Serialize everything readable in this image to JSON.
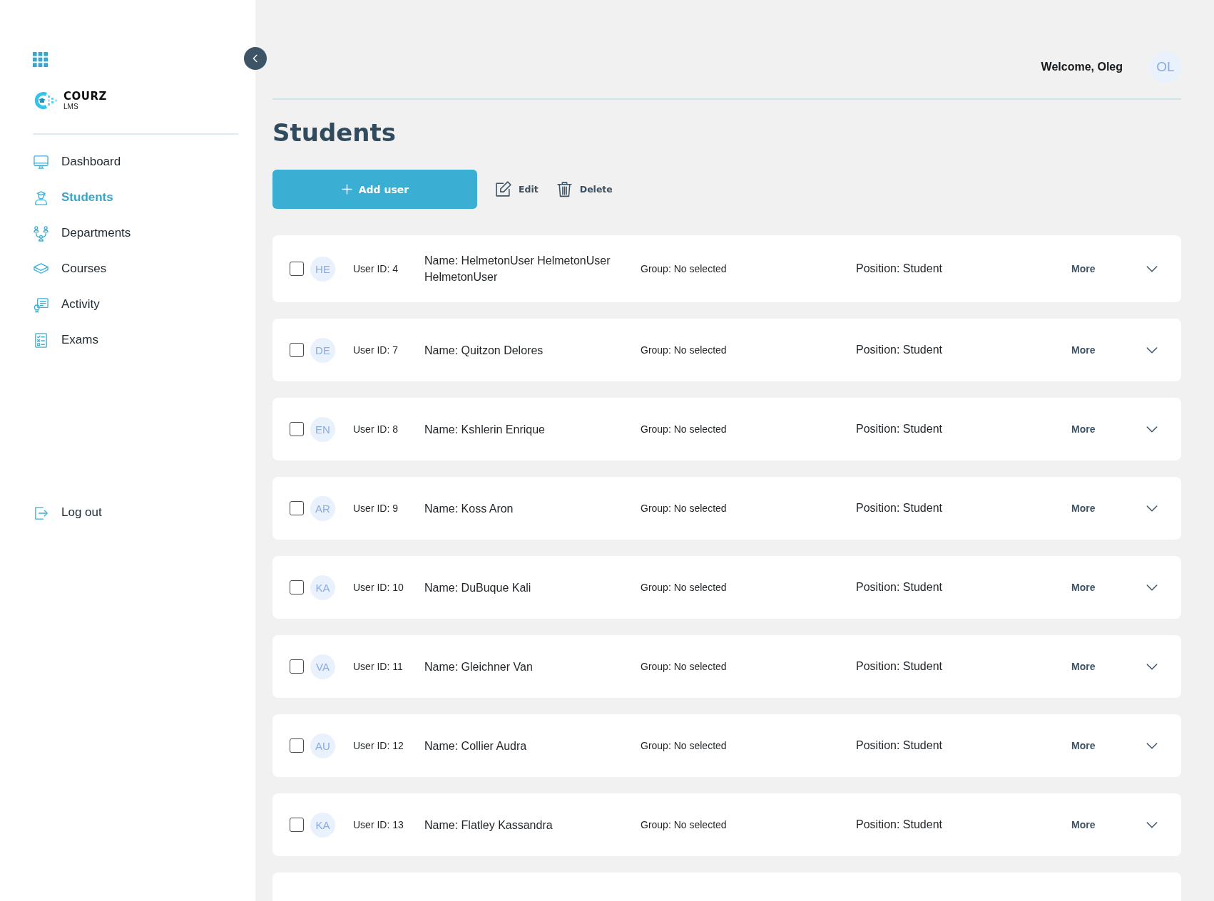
{
  "sidebar": {
    "logo": {
      "name": "COURZ",
      "tagline": "LMS"
    },
    "nav": [
      {
        "label": "Dashboard",
        "selected": false
      },
      {
        "label": "Students",
        "selected": true
      },
      {
        "label": "Departments",
        "selected": false
      },
      {
        "label": "Courses",
        "selected": false
      },
      {
        "label": "Activity",
        "selected": false
      },
      {
        "label": "Exams",
        "selected": false
      }
    ],
    "logout": {
      "label": "Log out"
    }
  },
  "header": {
    "welcome": "Welcome, Oleg",
    "avatar": "OL"
  },
  "page": {
    "title": "Students",
    "toolbar": {
      "add_user": "Add user",
      "edit": "Edit",
      "delete": "Delete"
    }
  },
  "rows": [
    {
      "checked": false,
      "initials": "HE",
      "user_id": "User ID: 4",
      "name": "Name: HelmetonUser HelmetonUser HelmetonUser",
      "group": "Group: No selected",
      "position": "Position: Student",
      "more": "More",
      "expanded": false
    },
    {
      "checked": false,
      "initials": "DE",
      "user_id": "User ID: 7",
      "name": "Name: Quitzon Delores",
      "group": "Group: No selected",
      "position": "Position: Student",
      "more": "More",
      "expanded": false
    },
    {
      "checked": false,
      "initials": "EN",
      "user_id": "User ID: 8",
      "name": "Name: Kshlerin Enrique",
      "group": "Group: No selected",
      "position": "Position: Student",
      "more": "More",
      "expanded": false
    },
    {
      "checked": false,
      "initials": "AR",
      "user_id": "User ID: 9",
      "name": "Name: Koss Aron",
      "group": "Group: No selected",
      "position": "Position: Student",
      "more": "More",
      "expanded": false
    },
    {
      "checked": false,
      "initials": "KA",
      "user_id": "User ID: 10",
      "name": "Name: DuBuque Kali",
      "group": "Group: No selected",
      "position": "Position: Student",
      "more": "More",
      "expanded": false
    },
    {
      "checked": false,
      "initials": "VA",
      "user_id": "User ID: 11",
      "name": "Name: Gleichner Van",
      "group": "Group: No selected",
      "position": "Position: Student",
      "more": "More",
      "expanded": false
    },
    {
      "checked": false,
      "initials": "AU",
      "user_id": "User ID: 12",
      "name": "Name: Collier Audra",
      "group": "Group: No selected",
      "position": "Position: Student",
      "more": "More",
      "expanded": false
    },
    {
      "checked": false,
      "initials": "KA",
      "user_id": "User ID: 13",
      "name": "Name: Flatley Kassandra",
      "group": "Group: No selected",
      "position": "Position: Student",
      "more": "More",
      "expanded": false
    }
  ]
}
